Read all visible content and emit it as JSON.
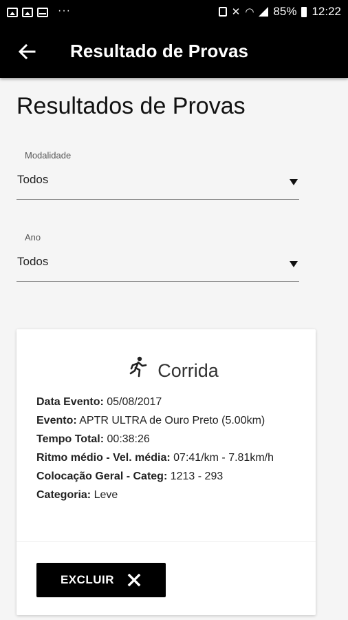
{
  "status_bar": {
    "battery": "85%",
    "time": "12:22",
    "dots": "···"
  },
  "app_bar": {
    "title": "Resultado de Provas"
  },
  "page": {
    "title": "Resultados de Provas"
  },
  "filters": [
    {
      "label": "Modalidade",
      "value": "Todos"
    },
    {
      "label": "Ano",
      "value": "Todos"
    }
  ],
  "result_card": {
    "icon": "running-icon",
    "title": "Corrida",
    "rows": [
      {
        "label": "Data Evento:",
        "value": "05/08/2017"
      },
      {
        "label": "Evento:",
        "value": "APTR ULTRA de Ouro Preto (5.00km)"
      },
      {
        "label": "Tempo Total:",
        "value": "00:38:26"
      },
      {
        "label": "Ritmo médio - Vel. média:",
        "value": "07:41/km - 7.81km/h"
      },
      {
        "label": "Colocação Geral - Categ:",
        "value": "1213 - 293"
      },
      {
        "label": "Categoria:",
        "value": "Leve"
      }
    ],
    "delete_label": "EXCLUIR"
  },
  "colors": {
    "app_bar": "#000000",
    "background": "#f5f5f5",
    "card": "#ffffff",
    "button": "#000000"
  }
}
